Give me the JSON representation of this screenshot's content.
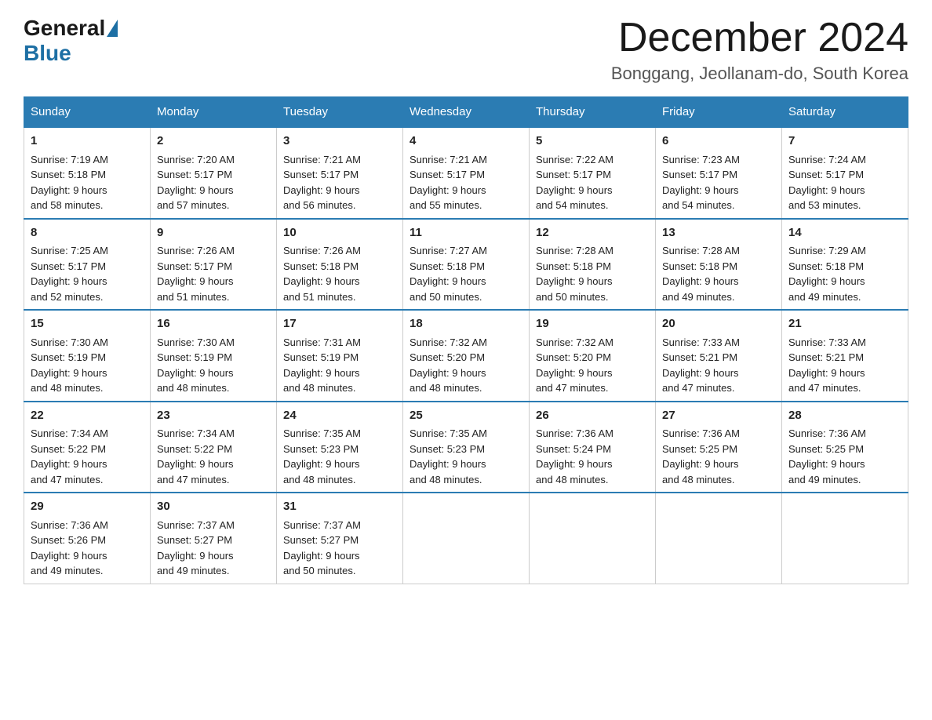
{
  "logo": {
    "general": "General",
    "blue": "Blue"
  },
  "header": {
    "month_year": "December 2024",
    "location": "Bonggang, Jeollanam-do, South Korea"
  },
  "weekdays": [
    "Sunday",
    "Monday",
    "Tuesday",
    "Wednesday",
    "Thursday",
    "Friday",
    "Saturday"
  ],
  "weeks": [
    [
      {
        "day": "1",
        "sunrise": "Sunrise: 7:19 AM",
        "sunset": "Sunset: 5:18 PM",
        "daylight": "Daylight: 9 hours",
        "minutes": "and 58 minutes."
      },
      {
        "day": "2",
        "sunrise": "Sunrise: 7:20 AM",
        "sunset": "Sunset: 5:17 PM",
        "daylight": "Daylight: 9 hours",
        "minutes": "and 57 minutes."
      },
      {
        "day": "3",
        "sunrise": "Sunrise: 7:21 AM",
        "sunset": "Sunset: 5:17 PM",
        "daylight": "Daylight: 9 hours",
        "minutes": "and 56 minutes."
      },
      {
        "day": "4",
        "sunrise": "Sunrise: 7:21 AM",
        "sunset": "Sunset: 5:17 PM",
        "daylight": "Daylight: 9 hours",
        "minutes": "and 55 minutes."
      },
      {
        "day": "5",
        "sunrise": "Sunrise: 7:22 AM",
        "sunset": "Sunset: 5:17 PM",
        "daylight": "Daylight: 9 hours",
        "minutes": "and 54 minutes."
      },
      {
        "day": "6",
        "sunrise": "Sunrise: 7:23 AM",
        "sunset": "Sunset: 5:17 PM",
        "daylight": "Daylight: 9 hours",
        "minutes": "and 54 minutes."
      },
      {
        "day": "7",
        "sunrise": "Sunrise: 7:24 AM",
        "sunset": "Sunset: 5:17 PM",
        "daylight": "Daylight: 9 hours",
        "minutes": "and 53 minutes."
      }
    ],
    [
      {
        "day": "8",
        "sunrise": "Sunrise: 7:25 AM",
        "sunset": "Sunset: 5:17 PM",
        "daylight": "Daylight: 9 hours",
        "minutes": "and 52 minutes."
      },
      {
        "day": "9",
        "sunrise": "Sunrise: 7:26 AM",
        "sunset": "Sunset: 5:17 PM",
        "daylight": "Daylight: 9 hours",
        "minutes": "and 51 minutes."
      },
      {
        "day": "10",
        "sunrise": "Sunrise: 7:26 AM",
        "sunset": "Sunset: 5:18 PM",
        "daylight": "Daylight: 9 hours",
        "minutes": "and 51 minutes."
      },
      {
        "day": "11",
        "sunrise": "Sunrise: 7:27 AM",
        "sunset": "Sunset: 5:18 PM",
        "daylight": "Daylight: 9 hours",
        "minutes": "and 50 minutes."
      },
      {
        "day": "12",
        "sunrise": "Sunrise: 7:28 AM",
        "sunset": "Sunset: 5:18 PM",
        "daylight": "Daylight: 9 hours",
        "minutes": "and 50 minutes."
      },
      {
        "day": "13",
        "sunrise": "Sunrise: 7:28 AM",
        "sunset": "Sunset: 5:18 PM",
        "daylight": "Daylight: 9 hours",
        "minutes": "and 49 minutes."
      },
      {
        "day": "14",
        "sunrise": "Sunrise: 7:29 AM",
        "sunset": "Sunset: 5:18 PM",
        "daylight": "Daylight: 9 hours",
        "minutes": "and 49 minutes."
      }
    ],
    [
      {
        "day": "15",
        "sunrise": "Sunrise: 7:30 AM",
        "sunset": "Sunset: 5:19 PM",
        "daylight": "Daylight: 9 hours",
        "minutes": "and 48 minutes."
      },
      {
        "day": "16",
        "sunrise": "Sunrise: 7:30 AM",
        "sunset": "Sunset: 5:19 PM",
        "daylight": "Daylight: 9 hours",
        "minutes": "and 48 minutes."
      },
      {
        "day": "17",
        "sunrise": "Sunrise: 7:31 AM",
        "sunset": "Sunset: 5:19 PM",
        "daylight": "Daylight: 9 hours",
        "minutes": "and 48 minutes."
      },
      {
        "day": "18",
        "sunrise": "Sunrise: 7:32 AM",
        "sunset": "Sunset: 5:20 PM",
        "daylight": "Daylight: 9 hours",
        "minutes": "and 48 minutes."
      },
      {
        "day": "19",
        "sunrise": "Sunrise: 7:32 AM",
        "sunset": "Sunset: 5:20 PM",
        "daylight": "Daylight: 9 hours",
        "minutes": "and 47 minutes."
      },
      {
        "day": "20",
        "sunrise": "Sunrise: 7:33 AM",
        "sunset": "Sunset: 5:21 PM",
        "daylight": "Daylight: 9 hours",
        "minutes": "and 47 minutes."
      },
      {
        "day": "21",
        "sunrise": "Sunrise: 7:33 AM",
        "sunset": "Sunset: 5:21 PM",
        "daylight": "Daylight: 9 hours",
        "minutes": "and 47 minutes."
      }
    ],
    [
      {
        "day": "22",
        "sunrise": "Sunrise: 7:34 AM",
        "sunset": "Sunset: 5:22 PM",
        "daylight": "Daylight: 9 hours",
        "minutes": "and 47 minutes."
      },
      {
        "day": "23",
        "sunrise": "Sunrise: 7:34 AM",
        "sunset": "Sunset: 5:22 PM",
        "daylight": "Daylight: 9 hours",
        "minutes": "and 47 minutes."
      },
      {
        "day": "24",
        "sunrise": "Sunrise: 7:35 AM",
        "sunset": "Sunset: 5:23 PM",
        "daylight": "Daylight: 9 hours",
        "minutes": "and 48 minutes."
      },
      {
        "day": "25",
        "sunrise": "Sunrise: 7:35 AM",
        "sunset": "Sunset: 5:23 PM",
        "daylight": "Daylight: 9 hours",
        "minutes": "and 48 minutes."
      },
      {
        "day": "26",
        "sunrise": "Sunrise: 7:36 AM",
        "sunset": "Sunset: 5:24 PM",
        "daylight": "Daylight: 9 hours",
        "minutes": "and 48 minutes."
      },
      {
        "day": "27",
        "sunrise": "Sunrise: 7:36 AM",
        "sunset": "Sunset: 5:25 PM",
        "daylight": "Daylight: 9 hours",
        "minutes": "and 48 minutes."
      },
      {
        "day": "28",
        "sunrise": "Sunrise: 7:36 AM",
        "sunset": "Sunset: 5:25 PM",
        "daylight": "Daylight: 9 hours",
        "minutes": "and 49 minutes."
      }
    ],
    [
      {
        "day": "29",
        "sunrise": "Sunrise: 7:36 AM",
        "sunset": "Sunset: 5:26 PM",
        "daylight": "Daylight: 9 hours",
        "minutes": "and 49 minutes."
      },
      {
        "day": "30",
        "sunrise": "Sunrise: 7:37 AM",
        "sunset": "Sunset: 5:27 PM",
        "daylight": "Daylight: 9 hours",
        "minutes": "and 49 minutes."
      },
      {
        "day": "31",
        "sunrise": "Sunrise: 7:37 AM",
        "sunset": "Sunset: 5:27 PM",
        "daylight": "Daylight: 9 hours",
        "minutes": "and 50 minutes."
      },
      null,
      null,
      null,
      null
    ]
  ]
}
